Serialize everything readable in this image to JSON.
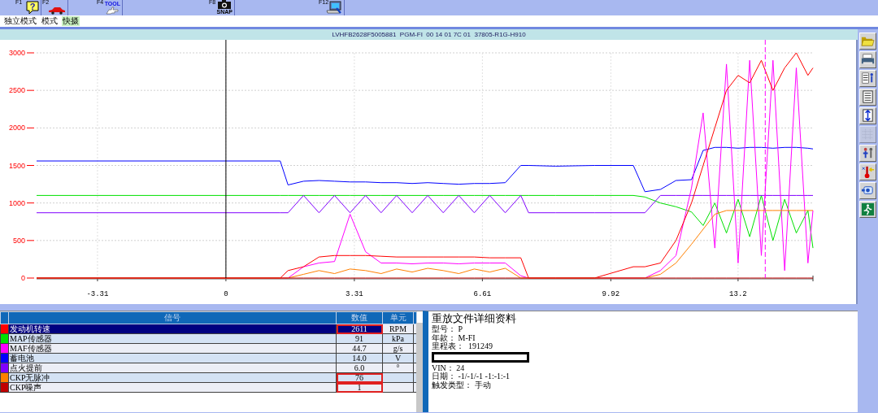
{
  "function_keys": [
    {
      "key": "F1",
      "glyph": "?"
    },
    {
      "key": "F2"
    },
    {
      "key": "F4",
      "caption": "TOOL"
    },
    {
      "key": "F8",
      "caption": "SNAP"
    },
    {
      "key": "F12"
    }
  ],
  "modes": [
    {
      "label": "独立模式",
      "selected": false
    },
    {
      "label": "模式",
      "selected": false
    },
    {
      "label": "快摄",
      "selected": true
    }
  ],
  "title": "LVHFB2628F5005881  PGM-FI  00 14 01 7C 01  37805-R1G-H910",
  "chart": {
    "chart_data": {
      "type": "line",
      "xlim": [
        -4.88,
        15.13
      ],
      "ylim": [
        0,
        3000
      ],
      "xticks": [
        {
          "value": -3.31,
          "label": "-3.31"
        },
        {
          "value": 0,
          "label": "0"
        },
        {
          "value": 3.31,
          "label": "3.31"
        },
        {
          "value": 6.61,
          "label": "6.61"
        },
        {
          "value": 9.92,
          "label": "9.92"
        },
        {
          "value": 13.2,
          "label": "13.2"
        }
      ],
      "yticks": [
        0,
        500,
        1000,
        1500,
        2000,
        2500,
        3000
      ],
      "x": [
        -4.88,
        1.4,
        1.6,
        2.0,
        2.4,
        2.8,
        3.2,
        3.6,
        4.0,
        4.4,
        4.8,
        5.2,
        5.6,
        6.0,
        6.4,
        6.8,
        7.2,
        7.6,
        7.8,
        8.5,
        9.5,
        10.5,
        10.8,
        11.2,
        11.6,
        12.0,
        12.3,
        12.6,
        12.9,
        13.2,
        13.5,
        13.8,
        14.1,
        14.4,
        14.7,
        15.0,
        15.13
      ],
      "series": [
        {
          "color": "#0000ff",
          "values": [
            1560,
            1560,
            1240,
            1290,
            1300,
            1290,
            1280,
            1280,
            1270,
            1270,
            1260,
            1270,
            1260,
            1250,
            1260,
            1260,
            1270,
            1500,
            1500,
            1490,
            1500,
            1500,
            1150,
            1180,
            1300,
            1310,
            1700,
            1740,
            1740,
            1730,
            1740,
            1740,
            1730,
            1740,
            1740,
            1730,
            1720
          ]
        },
        {
          "color": "#00e000",
          "values": [
            1100,
            1100,
            1100,
            1100,
            1100,
            1100,
            1100,
            1100,
            1100,
            1100,
            1100,
            1100,
            1100,
            1100,
            1100,
            1100,
            1100,
            1100,
            1100,
            1100,
            1100,
            1100,
            1080,
            1000,
            950,
            880,
            700,
            1000,
            600,
            1050,
            550,
            1100,
            500,
            1050,
            600,
            900,
            400
          ]
        },
        {
          "color": "#8000ff",
          "values": [
            870,
            870,
            870,
            1100,
            870,
            1100,
            870,
            1100,
            870,
            1100,
            870,
            1100,
            870,
            1100,
            870,
            1100,
            870,
            1100,
            870,
            870,
            870,
            870,
            870,
            1100,
            1100,
            1100,
            1100,
            1100,
            1100,
            1100,
            1100,
            1100,
            1100,
            1100,
            1100,
            1100,
            1100
          ]
        },
        {
          "color": "#ff00ff",
          "values": [
            0,
            0,
            0,
            150,
            200,
            220,
            850,
            350,
            200,
            200,
            190,
            200,
            200,
            190,
            200,
            200,
            200,
            30,
            0,
            0,
            0,
            0,
            0,
            100,
            300,
            1200,
            2200,
            400,
            2850,
            200,
            2900,
            300,
            2900,
            100,
            2800,
            200,
            900
          ]
        },
        {
          "color": "#ff0000",
          "values": [
            0,
            0,
            100,
            150,
            280,
            300,
            300,
            300,
            290,
            280,
            280,
            280,
            280,
            280,
            280,
            270,
            270,
            270,
            0,
            0,
            0,
            150,
            150,
            200,
            500,
            1000,
            1500,
            2000,
            2500,
            2700,
            2600,
            2900,
            2500,
            2800,
            3000,
            2700,
            2800
          ]
        },
        {
          "color": "#ff8000",
          "values": [
            0,
            0,
            0,
            50,
            100,
            60,
            120,
            100,
            60,
            120,
            80,
            130,
            100,
            60,
            120,
            80,
            130,
            0,
            0,
            0,
            0,
            0,
            0,
            50,
            200,
            450,
            650,
            850,
            900,
            900,
            900,
            900,
            900,
            900,
            900,
            900,
            900
          ]
        },
        {
          "color": "#c00000",
          "values": [
            0,
            0,
            0,
            0,
            0,
            0,
            0,
            0,
            0,
            0,
            0,
            0,
            0,
            0,
            0,
            0,
            0,
            0,
            0,
            0,
            0,
            0,
            0,
            0,
            0,
            0,
            0,
            0,
            0,
            0,
            0,
            0,
            0,
            0,
            0,
            0,
            0
          ]
        }
      ],
      "grid": true,
      "ref_lines": [
        {
          "axis": "x",
          "value": 0,
          "color": "#000000"
        },
        {
          "axis": "x",
          "value": 13.9,
          "color": "#ff00ff"
        }
      ]
    }
  },
  "table": {
    "columns": [
      "信号",
      "数值",
      "单元"
    ],
    "rows": [
      {
        "color": "#ff0000",
        "name": "发动机转速",
        "value": "2611",
        "unit": "RPM",
        "selected": true,
        "highlighted": true
      },
      {
        "color": "#00e000",
        "name": "MAP传感器",
        "value": "91",
        "unit": "kPa",
        "selected": false,
        "highlighted": false
      },
      {
        "color": "#ff00ff",
        "name": "MAF传感器",
        "value": "44.7",
        "unit": "g/s",
        "selected": false,
        "highlighted": false
      },
      {
        "color": "#0000ff",
        "name": "蓄电池",
        "value": "14.0",
        "unit": "V",
        "selected": false,
        "highlighted": false
      },
      {
        "color": "#8000ff",
        "name": "点火提前",
        "value": "6.0",
        "unit": "°",
        "selected": false,
        "highlighted": false
      },
      {
        "color": "#ff8000",
        "name": "CKP无脉冲",
        "value": "76",
        "selected": false,
        "highlighted": true
      },
      {
        "color": "#c00000",
        "name": "CKP噪声",
        "value": "1",
        "selected": false,
        "highlighted": true
      }
    ]
  },
  "details": {
    "title": "重放文件详细资料",
    "lines": [
      {
        "kind": "text",
        "text": "型号： P"
      },
      {
        "kind": "text",
        "text": "年款： M-FI"
      },
      {
        "kind": "text",
        "text": "里程表：  191249"
      },
      {
        "kind": "redacted"
      },
      {
        "kind": "text",
        "text": "VIN： 24"
      },
      {
        "kind": "text",
        "text": "日期： -1/-1/-1 -1:-1:-1"
      },
      {
        "kind": "text",
        "text": "触发类型： 手动"
      }
    ]
  },
  "side_tools": [
    {
      "disabled": false
    },
    {
      "disabled": false
    },
    {
      "disabled": false
    },
    {
      "disabled": false
    },
    {
      "disabled": false
    },
    {
      "disabled": true
    },
    {
      "disabled": false
    },
    {
      "disabled": false
    },
    {
      "disabled": false
    },
    {
      "disabled": false
    }
  ]
}
